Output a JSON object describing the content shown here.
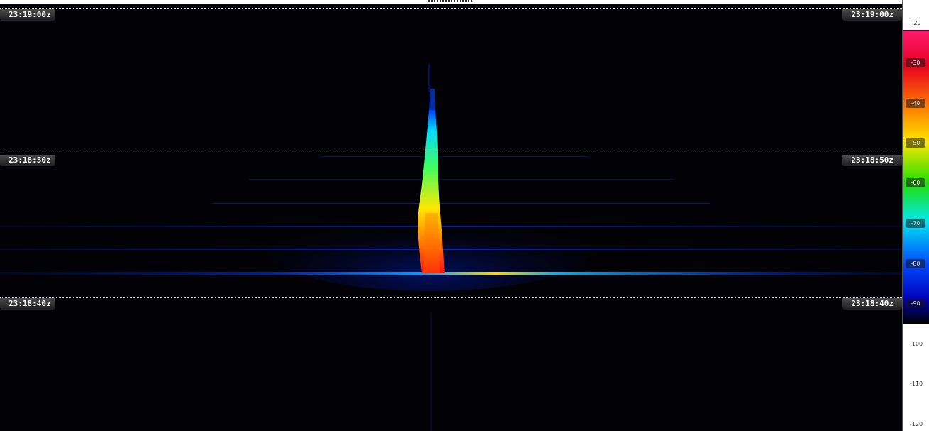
{
  "waterfall": {
    "time_labels": [
      "23:19:00z",
      "23:18:50z",
      "23:18:40z"
    ]
  },
  "scale": {
    "ticks": [
      "-20",
      "-30",
      "-40",
      "-50",
      "-60",
      "-70",
      "-80",
      "-90",
      "-100",
      "-110",
      "-120"
    ],
    "colors": {
      "top": "#ff1a70",
      "red": "#e8001e",
      "orange": "#ff7a00",
      "yellow": "#ffe600",
      "green": "#22e000",
      "cyan": "#00e8f0",
      "blue": "#0048ff",
      "deep_blue": "#0000b8",
      "background": "#000000"
    }
  }
}
